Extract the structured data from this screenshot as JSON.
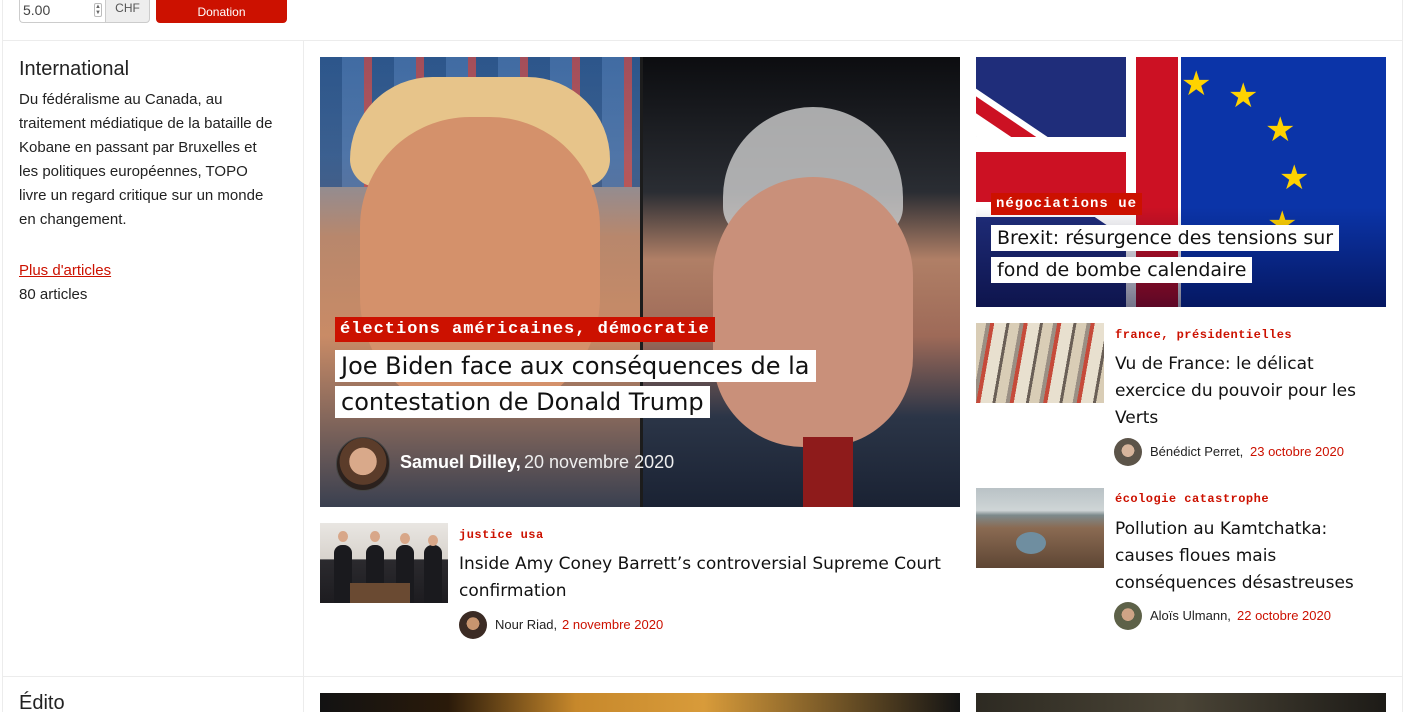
{
  "donation": {
    "amount": "5.00",
    "currency": "CHF",
    "button_label": "Donation"
  },
  "section": {
    "title": "International",
    "description": "Du fédéralisme au Canada, au traitement médiatique de la bataille de Kobane en passant par Bruxelles et les politiques européennes, TOPO livre un regard critique sur un monde en changement.",
    "more_link": "Plus d'articles",
    "count": "80 articles"
  },
  "next_section": {
    "title": "Édito"
  },
  "hero": {
    "tag": "élections américaines, démocratie",
    "title": "Joe Biden face aux conséquences de la contestation de Donald Trump",
    "author": "Samuel Dilley,",
    "date": "20 novembre 2020"
  },
  "article_amy": {
    "tag": "justice usa",
    "title": "Inside Amy Coney Barrett’s controversial Supreme Court confirmation",
    "author": "Nour Riad,",
    "date": "2 novembre 2020"
  },
  "brexit": {
    "tag": "négociations ue",
    "title": "Brexit: résurgence des tensions sur fond de bombe calendaire"
  },
  "article_france": {
    "tag": "france, présidentielles",
    "title": "Vu de France: le délicat exercice du pouvoir pour les Verts",
    "author": "Bénédict Perret,",
    "date": "23 octobre 2020"
  },
  "article_pollution": {
    "tag": "écologie catastrophe",
    "title": "Pollution au Kamtchatka: causes floues mais conséquences désastreuses",
    "author": "Aloïs Ulmann,",
    "date": "22 octobre 2020"
  },
  "colors": {
    "accent": "#cc1100",
    "border": "#ececec"
  }
}
